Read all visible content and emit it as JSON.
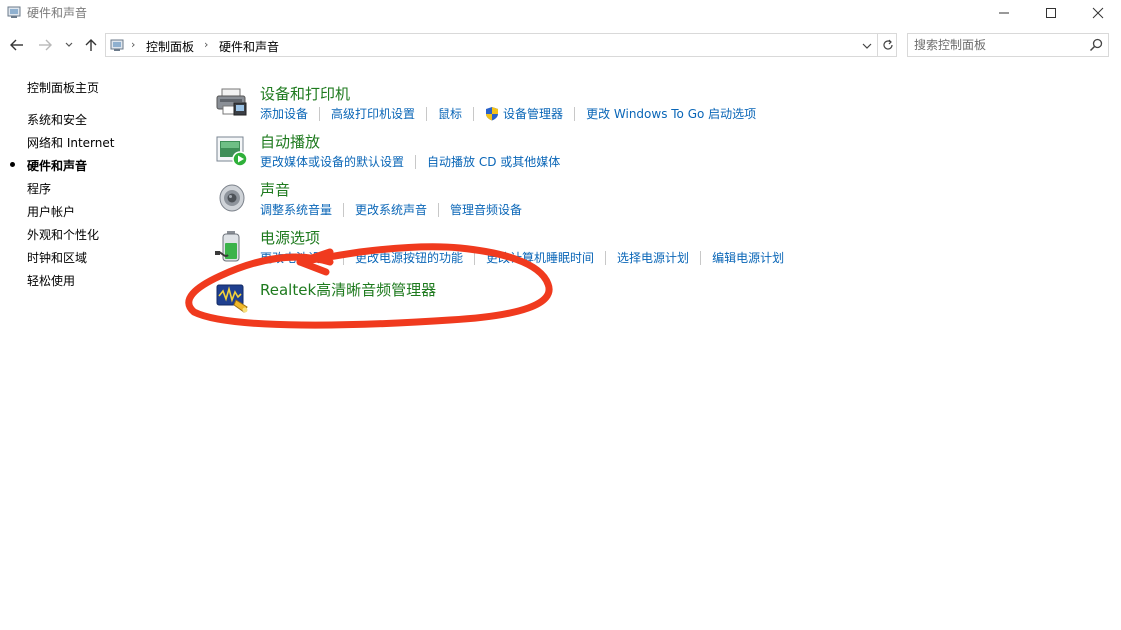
{
  "window": {
    "title": "硬件和声音",
    "icons": [
      "control-panel-icon",
      "minimize-icon",
      "maximize-icon",
      "close-icon"
    ]
  },
  "address": {
    "crumbs": [
      "控制面板",
      "硬件和声音"
    ],
    "search_placeholder": "搜索控制面板"
  },
  "sidebar": {
    "items": [
      {
        "label": "控制面板主页"
      },
      {
        "label": "系统和安全"
      },
      {
        "label": "网络和 Internet"
      },
      {
        "label": "硬件和声音",
        "active": true
      },
      {
        "label": "程序"
      },
      {
        "label": "用户帐户"
      },
      {
        "label": "外观和个性化"
      },
      {
        "label": "时钟和区域"
      },
      {
        "label": "轻松使用"
      }
    ]
  },
  "categories": [
    {
      "title": "设备和打印机",
      "icon": "printer-icon",
      "links": [
        "添加设备",
        "高级打印机设置",
        "鼠标",
        "设备管理器",
        "更改 Windows To Go 启动选项"
      ]
    },
    {
      "title": "自动播放",
      "icon": "autoplay-icon",
      "links": [
        "更改媒体或设备的默认设置",
        "自动播放 CD 或其他媒体"
      ]
    },
    {
      "title": "声音",
      "icon": "speaker-icon",
      "links": [
        "调整系统音量",
        "更改系统声音",
        "管理音频设备"
      ]
    },
    {
      "title": "电源选项",
      "icon": "battery-icon",
      "links": [
        "更改电池设置",
        "更改电源按钮的功能",
        "更改计算机睡眠时间",
        "选择电源计划",
        "编辑电源计划"
      ]
    },
    {
      "title": "Realtek高清晰音频管理器",
      "icon": "realtek-audio-icon",
      "links": []
    }
  ],
  "colors": {
    "category_title": "#1e7a1e",
    "link": "#0a66b7",
    "annotation": "#f03a1e"
  }
}
